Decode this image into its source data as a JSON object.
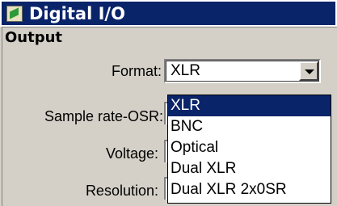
{
  "window": {
    "title": "Digital I/O",
    "icon": "app-icon"
  },
  "output": {
    "section_label": "Output",
    "format_label": "Format:",
    "format_value": "XLR",
    "sample_rate_label": "Sample rate-OSR:",
    "voltage_label": "Voltage:",
    "resolution_label": "Resolution:"
  },
  "dropdown": {
    "options": [
      "XLR",
      "BNC",
      "Optical",
      "Dual XLR",
      "Dual XLR 2x0SR"
    ],
    "selected_index": 0
  },
  "colors": {
    "selection": "#0a246a",
    "titlebar": "#0a246a",
    "face": "#d4d0c8"
  }
}
